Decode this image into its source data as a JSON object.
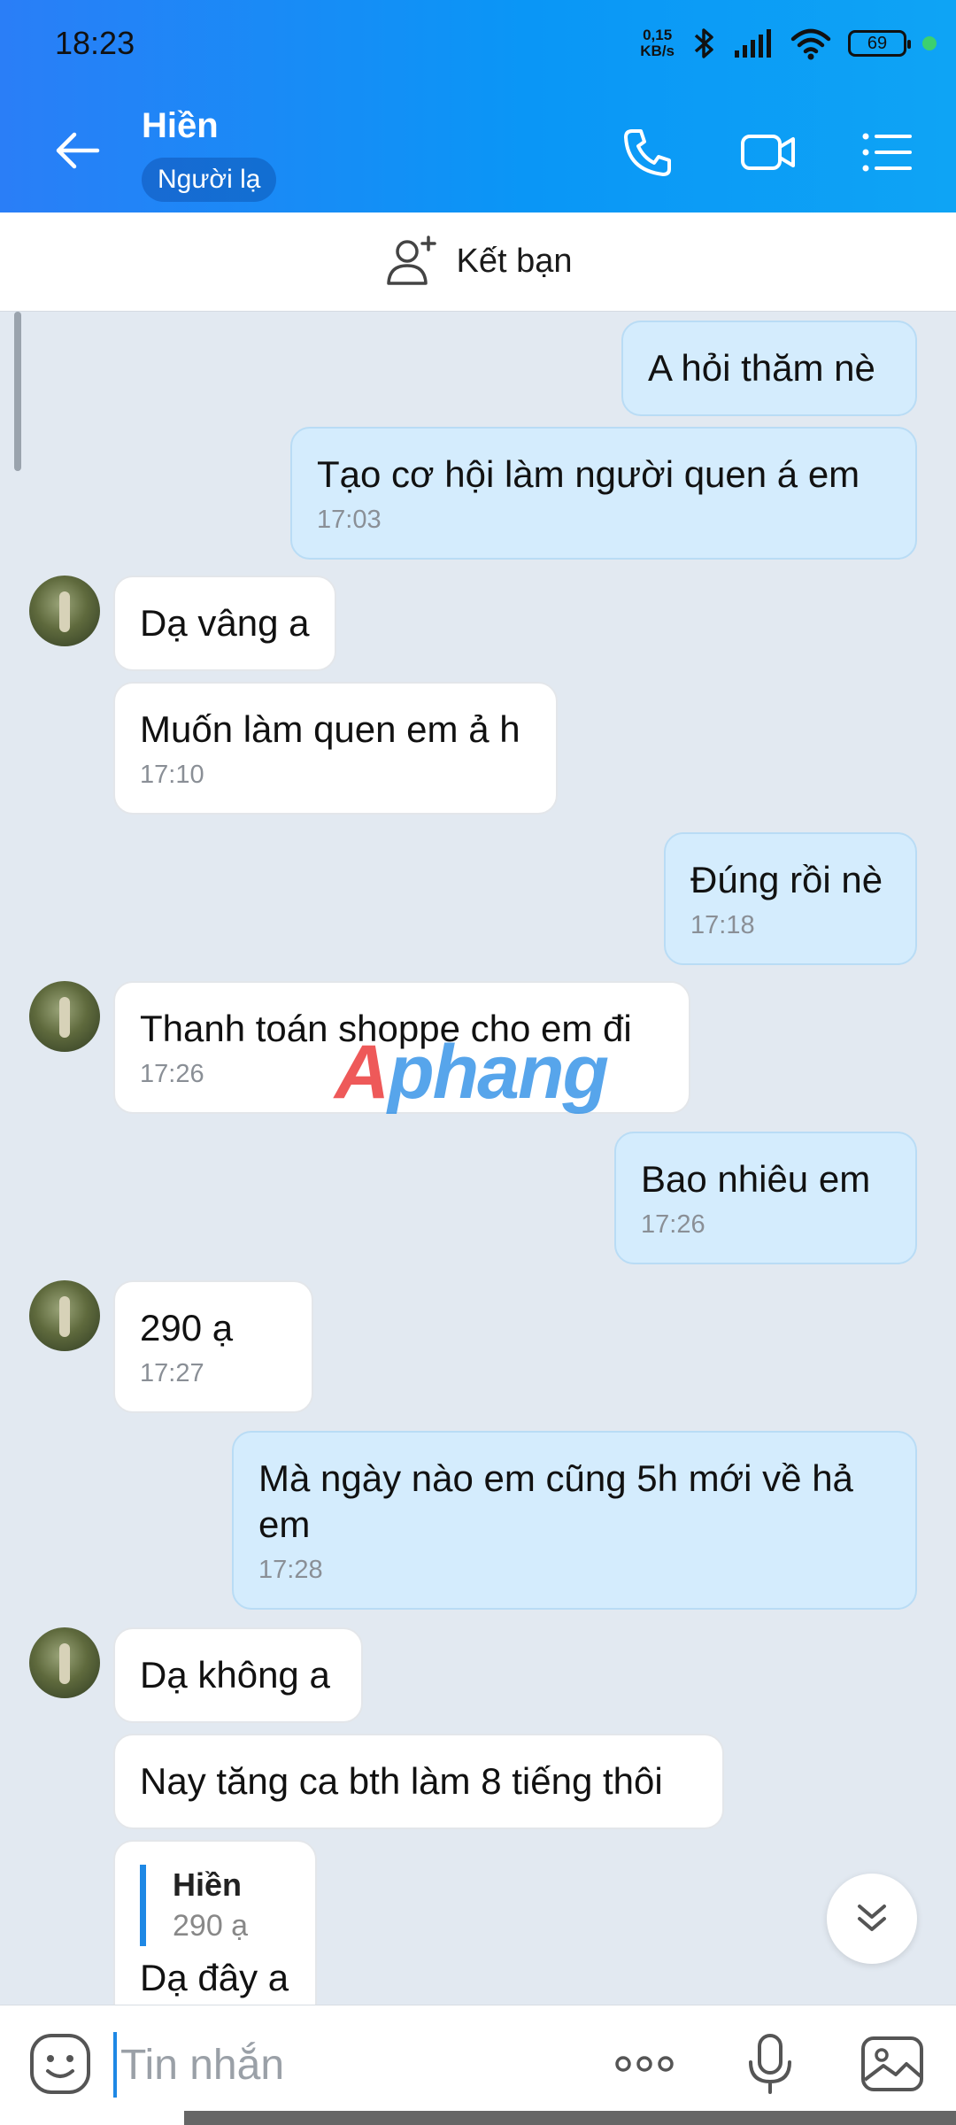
{
  "status": {
    "time": "18:23",
    "net_speed_value": "0,15",
    "net_speed_unit": "KB/s",
    "battery": "69"
  },
  "header": {
    "contact_name": "Hiền",
    "badge": "Người lạ"
  },
  "friend_bar": {
    "label": "Kết bạn"
  },
  "messages": [
    {
      "text": "A hỏi thăm nè",
      "time": ""
    },
    {
      "text": "Tạo cơ hội làm người quen á em",
      "time": "17:03"
    },
    {
      "text": "Dạ vâng a",
      "time": ""
    },
    {
      "text": "Muốn làm quen em ả h",
      "time": "17:10"
    },
    {
      "text": "Đúng rồi nè",
      "time": "17:18"
    },
    {
      "text": "Thanh toán shoppe cho em đi",
      "time": "17:26"
    },
    {
      "text": "Bao nhiêu em",
      "time": "17:26"
    },
    {
      "text": "290 ạ",
      "time": "17:27"
    },
    {
      "text": "Mà ngày nào em cũng 5h mới về hả em",
      "time": "17:28"
    },
    {
      "text": "Dạ không a",
      "time": ""
    },
    {
      "text": "Nay tăng ca bth làm 8 tiếng thôi",
      "time": ""
    },
    {
      "quote_name": "Hiền",
      "quote_text": "290 ạ",
      "text": "Dạ đây a",
      "time": ""
    }
  ],
  "watermark": {
    "part1": "A",
    "part2": "phang"
  },
  "input": {
    "placeholder": "Tin nhắn"
  }
}
